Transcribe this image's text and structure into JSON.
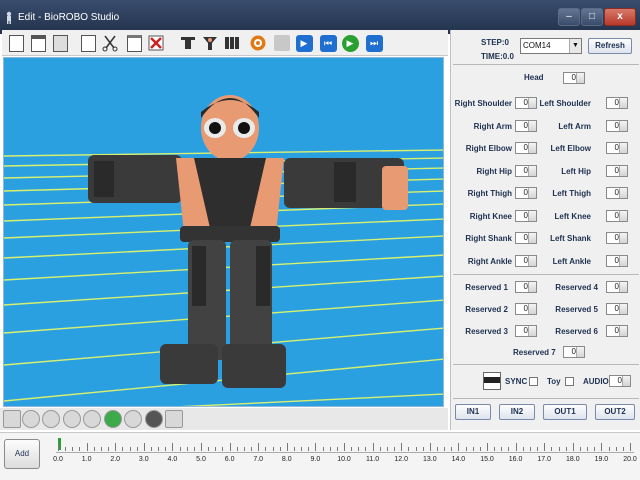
{
  "window": {
    "title": "Edit - BioROBO Studio"
  },
  "toolbar": {
    "icons": [
      "new-icon",
      "open-icon",
      "save-icon",
      "copy-icon",
      "cut-icon",
      "paste-icon",
      "delete-icon",
      "robot-pose-1-icon",
      "robot-pose-2-icon",
      "robot-pose-3-icon",
      "record-icon",
      "blank-icon",
      "play-icon",
      "rewind-icon",
      "run-icon",
      "forward-icon"
    ]
  },
  "status": {
    "step": "STEP:0",
    "time": "TIME:0.0"
  },
  "port": {
    "value": "COM14",
    "refresh_label": "Refresh"
  },
  "joints": {
    "head": {
      "label": "Head",
      "value": "0"
    },
    "pairs": [
      {
        "left_label": "Right Shoulder",
        "left_value": "0",
        "right_label": "Left Shoulder",
        "right_value": "0"
      },
      {
        "left_label": "Right Arm",
        "left_value": "0",
        "right_label": "Left Arm",
        "right_value": "0"
      },
      {
        "left_label": "Right Elbow",
        "left_value": "0",
        "right_label": "Left Elbow",
        "right_value": "0"
      },
      {
        "left_label": "Right Hip",
        "left_value": "0",
        "right_label": "Left Hip",
        "right_value": "0"
      },
      {
        "left_label": "Right Thigh",
        "left_value": "0",
        "right_label": "Left Thigh",
        "right_value": "0"
      },
      {
        "left_label": "Right Knee",
        "left_value": "0",
        "right_label": "Left Knee",
        "right_value": "0"
      },
      {
        "left_label": "Right Shank",
        "left_value": "0",
        "right_label": "Left Shank",
        "right_value": "0"
      },
      {
        "left_label": "Right Ankle",
        "left_value": "0",
        "right_label": "Left Ankle",
        "right_value": "0"
      }
    ]
  },
  "reserved": {
    "pairs": [
      {
        "left_label": "Reserved 1",
        "left_value": "0",
        "right_label": "Reserved 4",
        "right_value": "0"
      },
      {
        "left_label": "Reserved 2",
        "left_value": "0",
        "right_label": "Reserved 5",
        "right_value": "0"
      },
      {
        "left_label": "Reserved 3",
        "left_value": "0",
        "right_label": "Reserved 6",
        "right_value": "0"
      }
    ],
    "last": {
      "label": "Reserved 7",
      "value": "0"
    }
  },
  "options": {
    "sync_label": "SYNC",
    "toy_label": "Toy",
    "audio_label": "AUDIO",
    "audio_value": "0"
  },
  "io": {
    "in1": "IN1",
    "in2": "IN2",
    "out1": "OUT1",
    "out2": "OUT2"
  },
  "timeline": {
    "add_label": "Add",
    "ticks": [
      "0.0",
      "1.0",
      "2.0",
      "3.0",
      "4.0",
      "5.0",
      "6.0",
      "7.0",
      "8.0",
      "9.0",
      "10.0",
      "11.0",
      "12.0",
      "13.0",
      "14.0",
      "15.0",
      "16.0",
      "17.0",
      "18.0",
      "19.0",
      "20.0"
    ]
  },
  "colors": {
    "viewport_bg": "#2ba0e0",
    "ground_lines": "#d8f070",
    "robot_body": "#3a3a3a",
    "robot_skin": "#e89a72"
  }
}
